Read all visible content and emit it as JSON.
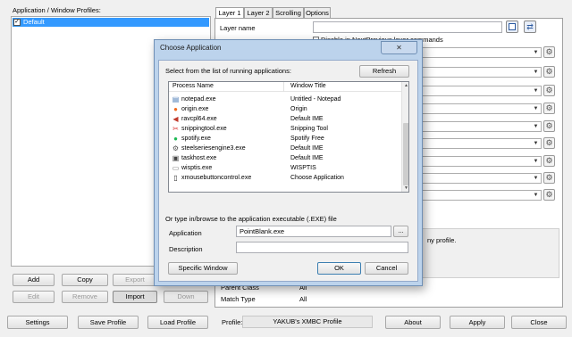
{
  "left_panel": {
    "title": "Application / Window Profiles:",
    "profiles": [
      {
        "label": "Default",
        "checked": true
      }
    ],
    "buttons_row1": [
      "Add",
      "Copy",
      "Export"
    ],
    "buttons_row2": [
      "Edit",
      "Remove",
      "Import",
      "Down"
    ]
  },
  "tabs": [
    "Layer 1",
    "Layer 2",
    "Scrolling",
    "Options"
  ],
  "layer": {
    "layer_name_label": "Layer name",
    "disable_label": "Disable in NextPrevious layer commands",
    "info_text": "ny profile.",
    "parent_class_label": "Parent Class",
    "parent_class_value": "All",
    "match_type_label": "Match Type",
    "match_type_value": "All"
  },
  "bottom_bar": {
    "settings": "Settings",
    "save_profile": "Save Profile",
    "load_profile": "Load Profile",
    "profile_label": "Profile:",
    "profile_value": "YAKUB's XMBC Profile",
    "about": "About",
    "apply": "Apply",
    "close": "Close"
  },
  "dialog": {
    "title": "Choose Application",
    "instruction": "Select from the list of running applications:",
    "refresh": "Refresh",
    "col_process": "Process Name",
    "col_title": "Window Title",
    "rows": [
      {
        "icon": "notepad-icon",
        "glyph": "▤",
        "color": "#4a7ab5",
        "process": "notepad.exe",
        "title": "Untitled - Notepad"
      },
      {
        "icon": "origin-icon",
        "glyph": "●",
        "color": "#f26b1d",
        "process": "origin.exe",
        "title": "Origin"
      },
      {
        "icon": "speaker-icon",
        "glyph": "◀",
        "color": "#c0392b",
        "process": "ravcpl64.exe",
        "title": "Default IME"
      },
      {
        "icon": "scissors-icon",
        "glyph": "✂",
        "color": "#d9302f",
        "process": "snippingtool.exe",
        "title": "Snipping Tool"
      },
      {
        "icon": "spotify-icon",
        "glyph": "●",
        "color": "#1db954",
        "process": "spotify.exe",
        "title": "Spotify Free"
      },
      {
        "icon": "steelseries-icon",
        "glyph": "⚙",
        "color": "#555555",
        "process": "steelseriesengine3.exe",
        "title": "Default IME"
      },
      {
        "icon": "taskhost-icon",
        "glyph": "▣",
        "color": "#444444",
        "process": "taskhost.exe",
        "title": "Default IME"
      },
      {
        "icon": "wisptis-icon",
        "glyph": "▭",
        "color": "#777777",
        "process": "wisptis.exe",
        "title": "WISPTIS"
      },
      {
        "icon": "mouse-icon",
        "glyph": "▯",
        "color": "#333333",
        "process": "xmousebuttoncontrol.exe",
        "title": "Choose Application"
      }
    ],
    "browse_label": "Or type in/browse to the application executable (.EXE) file",
    "application_label": "Application",
    "application_value": "PointBlank.exe",
    "browse_button": "...",
    "description_label": "Description",
    "description_value": "",
    "specific_window": "Specific Window",
    "ok": "OK",
    "cancel": "Cancel"
  }
}
